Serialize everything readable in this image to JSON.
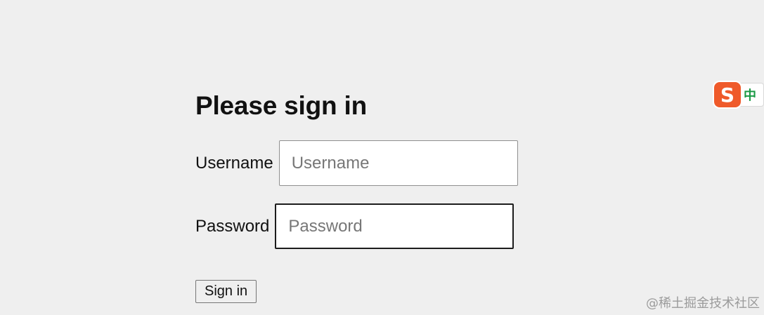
{
  "form": {
    "title": "Please sign in",
    "username_label": "Username",
    "username_placeholder": "Username",
    "password_label": "Password",
    "password_placeholder": "Password",
    "submit_label": "Sign in"
  },
  "ime": {
    "logo_glyph": "S",
    "mode_label": "中"
  },
  "watermark": "@稀土掘金技术社区",
  "colors": {
    "background": "#efefef",
    "ime_logo": "#ef5a2a",
    "ime_mode": "#1a9a45"
  }
}
